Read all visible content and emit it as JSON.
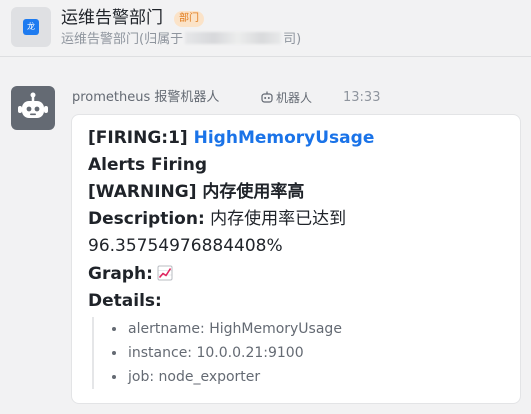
{
  "header": {
    "avatar_logo": "龙",
    "title": "运维告警部门",
    "tag": "部门",
    "subtitle_prefix": "运维告警部门(归属于",
    "subtitle_suffix": "司)"
  },
  "message": {
    "sender": "prometheus 报警机器人",
    "bot_badge": "机器人",
    "time": "13:33",
    "card": {
      "firing_prefix": "[FIRING:1]",
      "alert_name_link": "HighMemoryUsage",
      "alerts_firing": "Alerts Firing",
      "warning_line": "[WARNING] 内存使用率高",
      "description_label": "Description:",
      "description_text": "内存使用率已达到",
      "description_value": "96.35754976884408%",
      "graph_label": "Graph:",
      "details_label": "Details:",
      "details": [
        "alertname: HighMemoryUsage",
        "instance: 10.0.0.21:9100",
        "job: node_exporter"
      ]
    }
  },
  "colors": {
    "link": "#1a73e8",
    "tag_bg": "#fbe3c8",
    "tag_text": "#e07a1a",
    "bot_avatar": "#646a73",
    "logo": "#1e7bf0"
  }
}
